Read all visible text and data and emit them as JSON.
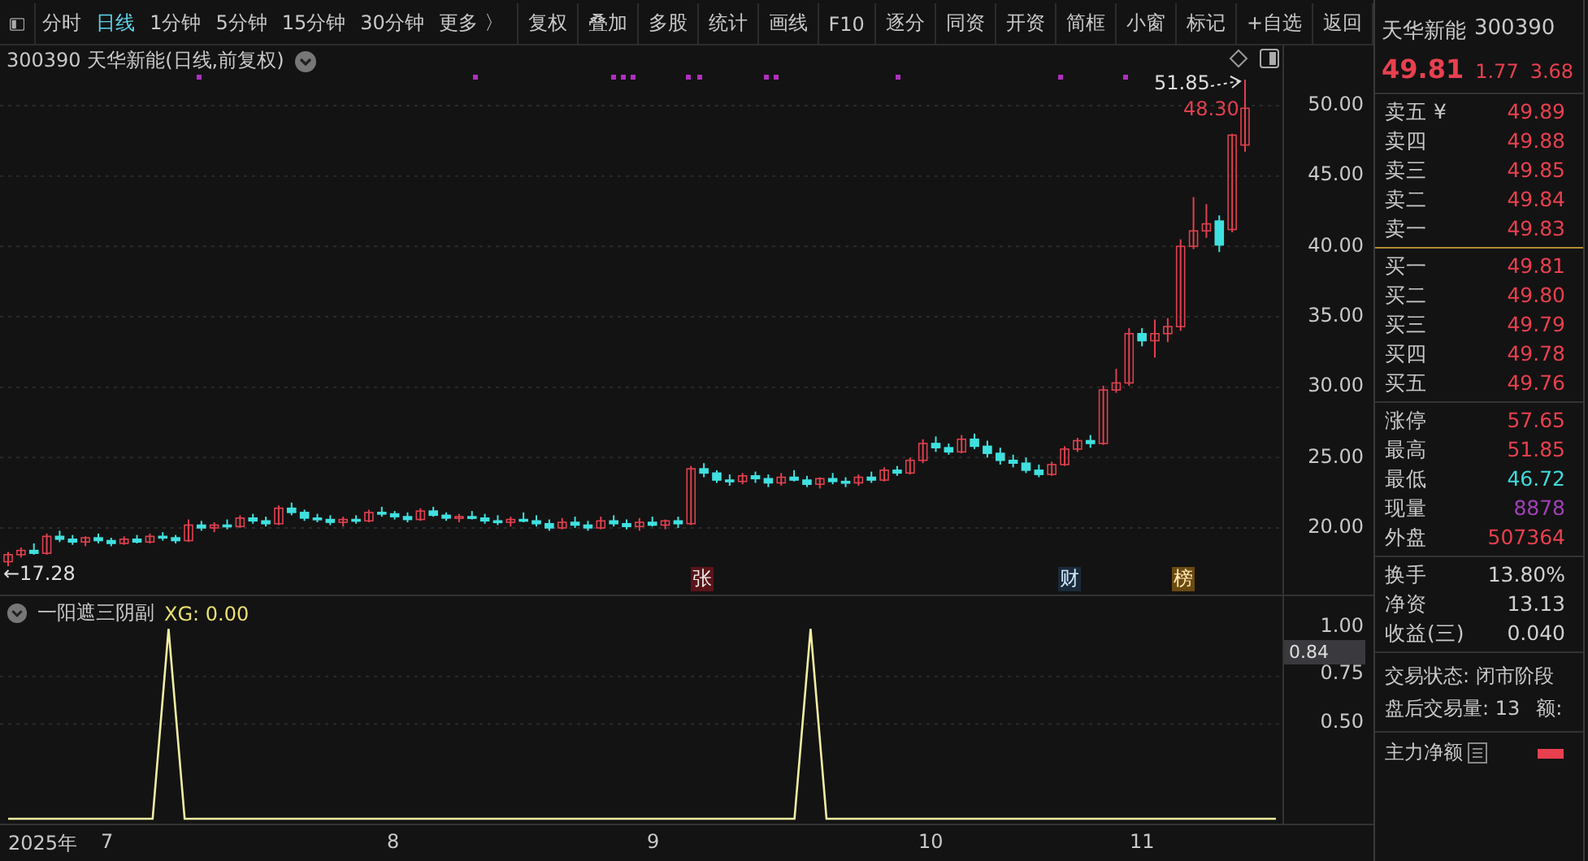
{
  "toolbar": {
    "periods": [
      {
        "label": "分时",
        "selected": false
      },
      {
        "label": "日线",
        "selected": true
      },
      {
        "label": "1分钟",
        "selected": false
      },
      {
        "label": "5分钟",
        "selected": false
      },
      {
        "label": "15分钟",
        "selected": false
      },
      {
        "label": "30分钟",
        "selected": false
      },
      {
        "label": "更多 〉",
        "selected": false
      }
    ],
    "buttons": [
      "复权",
      "叠加",
      "多股",
      "统计",
      "画线",
      "F10",
      "逐分",
      "同资",
      "开资",
      "简框",
      "小窗",
      "标记",
      "+自选",
      "返回"
    ]
  },
  "chart": {
    "title": "300390 天华新能(日线,前复权)",
    "high_label": "51.85",
    "close_label": "48.30",
    "low_label": "←17.28",
    "event_tags": [
      {
        "label": "张",
        "kind": "limit"
      },
      {
        "label": "财",
        "kind": "report"
      },
      {
        "label": "榜",
        "kind": "list"
      }
    ],
    "chart_data": {
      "type": "candlestick",
      "ylim": [
        15.15,
        54.27
      ],
      "grid": true,
      "yticks": [
        {
          "value": 50,
          "label": "50.00"
        },
        {
          "value": 45,
          "label": "45.00"
        },
        {
          "value": 40,
          "label": "40.00"
        },
        {
          "value": 35,
          "label": "35.00"
        },
        {
          "value": 30,
          "label": "30.00"
        },
        {
          "value": 25,
          "label": "25.00"
        },
        {
          "value": 20,
          "label": "20.00"
        }
      ],
      "ohlc": [
        [
          17.6,
          18.3,
          17.28,
          18.1
        ],
        [
          18.1,
          18.6,
          17.9,
          18.4
        ],
        [
          18.4,
          18.9,
          18.1,
          18.2
        ],
        [
          18.2,
          19.6,
          18.1,
          19.4
        ],
        [
          19.4,
          19.8,
          19.0,
          19.2
        ],
        [
          19.2,
          19.5,
          18.8,
          19.0
        ],
        [
          19.0,
          19.4,
          18.7,
          19.3
        ],
        [
          19.3,
          19.6,
          18.9,
          19.1
        ],
        [
          19.1,
          19.3,
          18.7,
          18.9
        ],
        [
          18.9,
          19.4,
          18.8,
          19.2
        ],
        [
          19.2,
          19.5,
          18.9,
          19.0
        ],
        [
          19.0,
          19.6,
          18.9,
          19.4
        ],
        [
          19.4,
          19.7,
          19.1,
          19.3
        ],
        [
          19.3,
          19.5,
          18.9,
          19.1
        ],
        [
          19.1,
          20.6,
          19.0,
          20.2
        ],
        [
          20.2,
          20.5,
          19.8,
          20.0
        ],
        [
          20.0,
          20.4,
          19.7,
          20.2
        ],
        [
          20.2,
          20.6,
          19.9,
          20.1
        ],
        [
          20.1,
          20.9,
          20.0,
          20.7
        ],
        [
          20.7,
          21.0,
          20.3,
          20.5
        ],
        [
          20.5,
          20.8,
          20.1,
          20.3
        ],
        [
          20.3,
          21.6,
          20.2,
          21.4
        ],
        [
          21.4,
          21.8,
          20.9,
          21.1
        ],
        [
          21.1,
          21.3,
          20.5,
          20.7
        ],
        [
          20.7,
          21.0,
          20.4,
          20.6
        ],
        [
          20.6,
          20.9,
          20.2,
          20.4
        ],
        [
          20.4,
          20.8,
          20.1,
          20.6
        ],
        [
          20.6,
          20.9,
          20.3,
          20.5
        ],
        [
          20.5,
          21.3,
          20.4,
          21.1
        ],
        [
          21.1,
          21.5,
          20.8,
          21.0
        ],
        [
          21.0,
          21.2,
          20.6,
          20.8
        ],
        [
          20.8,
          21.1,
          20.4,
          20.6
        ],
        [
          20.6,
          21.4,
          20.5,
          21.2
        ],
        [
          21.2,
          21.5,
          20.8,
          20.9
        ],
        [
          20.9,
          21.1,
          20.5,
          20.7
        ],
        [
          20.7,
          21.0,
          20.4,
          20.8
        ],
        [
          20.8,
          21.2,
          20.6,
          20.7
        ],
        [
          20.7,
          21.0,
          20.3,
          20.5
        ],
        [
          20.5,
          20.9,
          20.2,
          20.4
        ],
        [
          20.4,
          20.8,
          20.1,
          20.6
        ],
        [
          20.6,
          21.1,
          20.4,
          20.5
        ],
        [
          20.5,
          20.9,
          20.1,
          20.3
        ],
        [
          20.3,
          20.6,
          19.8,
          20.0
        ],
        [
          20.0,
          20.7,
          19.9,
          20.4
        ],
        [
          20.4,
          20.8,
          20.0,
          20.2
        ],
        [
          20.2,
          20.5,
          19.8,
          20.0
        ],
        [
          20.0,
          20.8,
          19.9,
          20.5
        ],
        [
          20.5,
          20.9,
          20.1,
          20.3
        ],
        [
          20.3,
          20.6,
          19.9,
          20.1
        ],
        [
          20.1,
          20.7,
          19.8,
          20.4
        ],
        [
          20.4,
          20.8,
          20.1,
          20.2
        ],
        [
          20.2,
          20.6,
          19.9,
          20.5
        ],
        [
          20.5,
          20.8,
          20.0,
          20.3
        ],
        [
          20.3,
          24.4,
          20.2,
          24.2
        ],
        [
          24.2,
          24.6,
          23.6,
          23.9
        ],
        [
          23.9,
          24.1,
          23.2,
          23.4
        ],
        [
          23.4,
          23.8,
          23.0,
          23.3
        ],
        [
          23.3,
          23.9,
          23.1,
          23.7
        ],
        [
          23.7,
          24.0,
          23.2,
          23.5
        ],
        [
          23.5,
          23.8,
          22.9,
          23.2
        ],
        [
          23.2,
          23.9,
          23.0,
          23.6
        ],
        [
          23.6,
          24.1,
          23.3,
          23.4
        ],
        [
          23.4,
          23.7,
          22.9,
          23.1
        ],
        [
          23.1,
          23.6,
          22.8,
          23.5
        ],
        [
          23.5,
          23.9,
          23.1,
          23.3
        ],
        [
          23.3,
          23.6,
          22.9,
          23.2
        ],
        [
          23.2,
          23.8,
          23.0,
          23.6
        ],
        [
          23.6,
          24.0,
          23.2,
          23.4
        ],
        [
          23.4,
          24.3,
          23.3,
          24.1
        ],
        [
          24.1,
          24.4,
          23.7,
          23.9
        ],
        [
          23.9,
          25.0,
          23.8,
          24.8
        ],
        [
          24.8,
          26.3,
          24.6,
          26.0
        ],
        [
          26.0,
          26.5,
          25.4,
          25.7
        ],
        [
          25.7,
          26.0,
          25.2,
          25.4
        ],
        [
          25.4,
          26.6,
          25.3,
          26.3
        ],
        [
          26.3,
          26.7,
          25.6,
          25.8
        ],
        [
          25.8,
          26.2,
          25.0,
          25.3
        ],
        [
          25.3,
          25.7,
          24.5,
          24.8
        ],
        [
          24.8,
          25.2,
          24.3,
          24.6
        ],
        [
          24.6,
          25.0,
          23.9,
          24.1
        ],
        [
          24.1,
          24.5,
          23.6,
          23.8
        ],
        [
          23.8,
          24.7,
          23.7,
          24.5
        ],
        [
          24.5,
          25.8,
          24.4,
          25.6
        ],
        [
          25.6,
          26.4,
          25.4,
          26.2
        ],
        [
          26.2,
          26.6,
          25.7,
          26.0
        ],
        [
          26.0,
          30.1,
          25.9,
          29.8
        ],
        [
          29.8,
          31.3,
          29.6,
          30.3
        ],
        [
          30.3,
          34.2,
          30.1,
          33.8
        ],
        [
          33.8,
          34.2,
          32.9,
          33.3
        ],
        [
          33.3,
          34.8,
          32.1,
          33.8
        ],
        [
          33.8,
          34.9,
          33.2,
          34.3
        ],
        [
          34.3,
          40.5,
          34.0,
          40.0
        ],
        [
          40.0,
          43.5,
          39.8,
          41.1
        ],
        [
          41.1,
          43.0,
          40.6,
          41.6
        ],
        [
          41.8,
          42.2,
          39.6,
          40.1
        ],
        [
          41.2,
          48.0,
          41.0,
          47.9
        ],
        [
          47.2,
          51.85,
          46.72,
          49.81
        ]
      ]
    }
  },
  "indicator": {
    "name": "一阳遮三阴副",
    "reading": ": 0.00",
    "cursor_value": "0.84",
    "chart_data": {
      "type": "line",
      "ylim": [
        -0.034,
        1.172
      ],
      "grid": true,
      "yticks": [
        {
          "value": 1,
          "label": "1.00"
        },
        {
          "value": 0.75,
          "label": "0.75"
        },
        {
          "value": 0.5,
          "label": "0.50"
        }
      ],
      "series": [
        {
          "name": "XG",
          "color": "#f2eea0",
          "values": [
            0,
            0,
            0,
            0,
            0,
            0,
            0,
            0,
            0,
            0,
            1,
            0,
            0,
            0,
            0,
            0,
            0,
            0,
            0,
            0,
            0,
            0,
            0,
            0,
            0,
            0,
            0,
            0,
            0,
            0,
            0,
            0,
            0,
            0,
            0,
            0,
            0,
            0,
            0,
            0,
            0,
            0,
            0,
            0,
            0,
            0,
            0,
            0,
            0,
            0,
            1,
            0,
            0,
            0,
            0,
            0,
            0,
            0,
            0,
            0,
            0,
            0,
            0,
            0,
            0,
            0,
            0,
            0,
            0,
            0,
            0,
            0,
            0,
            0,
            0,
            0,
            0,
            0,
            0,
            0
          ]
        }
      ]
    }
  },
  "x_axis": [
    "2025年",
    "7",
    "8",
    "9",
    "10",
    "11"
  ],
  "quote": {
    "name": "天华新能",
    "code": "300390",
    "price": "49.81",
    "change": "1.77",
    "change_pct": "3.68",
    "asks": [
      {
        "label": "卖五 ¥",
        "value": "49.89"
      },
      {
        "label": "卖四",
        "value": "49.88"
      },
      {
        "label": "卖三",
        "value": "49.85"
      },
      {
        "label": "卖二",
        "value": "49.84"
      },
      {
        "label": "卖一",
        "value": "49.83"
      }
    ],
    "bids": [
      {
        "label": "买一",
        "value": "49.81"
      },
      {
        "label": "买二",
        "value": "49.80"
      },
      {
        "label": "买三",
        "value": "49.79"
      },
      {
        "label": "买四",
        "value": "49.78"
      },
      {
        "label": "买五",
        "value": "49.76"
      }
    ],
    "stats": [
      {
        "label": "涨停",
        "value": "57.65",
        "color": "#e8404f"
      },
      {
        "label": "最高",
        "value": "51.85",
        "color": "#e8404f"
      },
      {
        "label": "最低",
        "value": "46.72",
        "color": "#40d8d8"
      },
      {
        "label": "现量",
        "value": "8878",
        "color": "#a040b8"
      },
      {
        "label": "外盘",
        "value": "507364",
        "color": "#e8404f"
      }
    ],
    "fundamentals": [
      {
        "label": "换手",
        "value": "13.80%"
      },
      {
        "label": "净资",
        "value": "13.13"
      },
      {
        "label": "收益(三)",
        "value": "0.040"
      }
    ],
    "trading_status": "交易状态: 闭市阶段",
    "after_hours_volume": "盘后交易量: 13",
    "after_hours_amount": "额:",
    "main_net": "主力净额"
  }
}
